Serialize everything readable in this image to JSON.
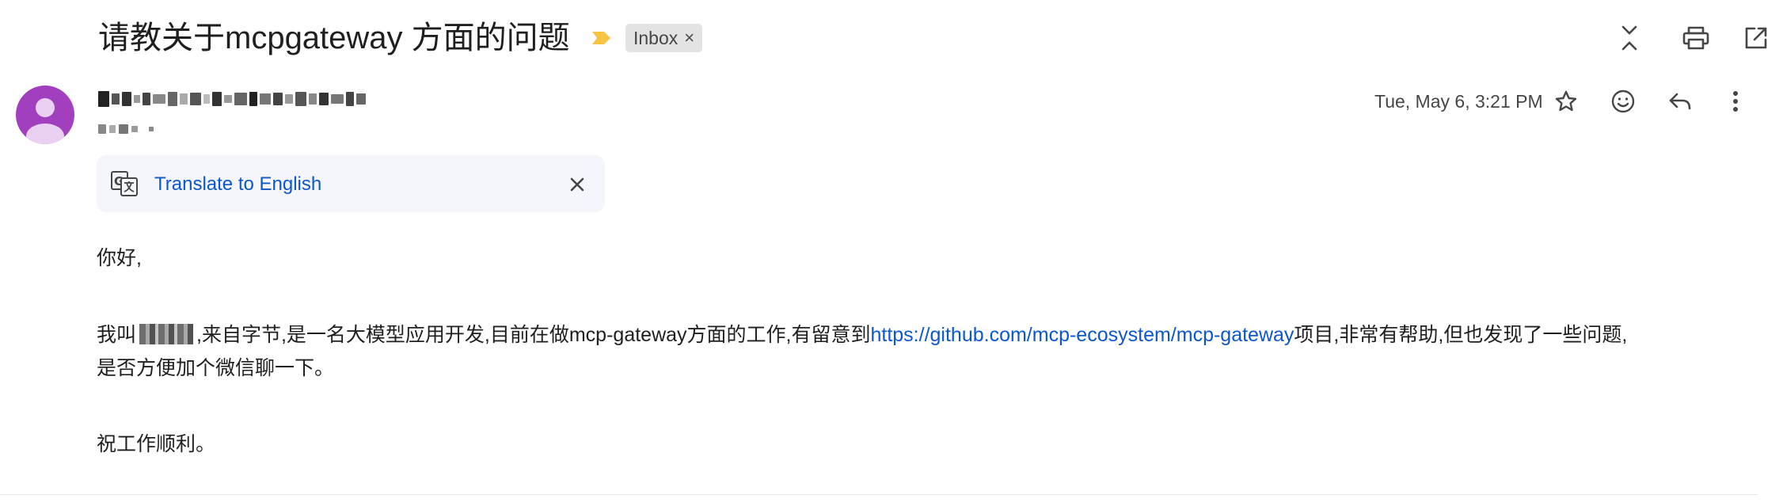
{
  "subject": "请教关于mcpgateway 方面的问题",
  "label": {
    "text": "Inbox",
    "remove": "×"
  },
  "icons": {
    "importance": "importance-marker-icon",
    "collapse": "collapse-all-icon",
    "print": "print-icon",
    "open_new_window": "open-in-new-window-icon",
    "star": "star-icon",
    "emoji": "emoji-reaction-icon",
    "reply": "reply-icon",
    "more": "more-vert-icon",
    "translate": "translate-icon",
    "close": "close-icon",
    "avatar": "avatar-person-icon"
  },
  "message": {
    "timestamp": "Tue, May 6, 3:21 PM"
  },
  "translate_banner": {
    "link": "Translate to English"
  },
  "body": {
    "greeting": "你好,",
    "p1_before": "我叫",
    "p1_middle": ",来自字节,是一名大模型应用开发,目前在做mcp-gateway方面的工作,有留意到",
    "p1_link": "https://github.com/mcp-ecosystem/mcp-gateway",
    "p1_after": "项目,非常有帮助,但也发现了一些问题,",
    "p1_line2": "是否方便加个微信聊一下。",
    "closing": "祝工作顺利。"
  },
  "colors": {
    "avatar": "#a23fbf",
    "link": "#0b57d0",
    "importance": "#f6c344",
    "chip_bg": "#e3e3e3",
    "banner_bg": "#f4f6fb"
  }
}
